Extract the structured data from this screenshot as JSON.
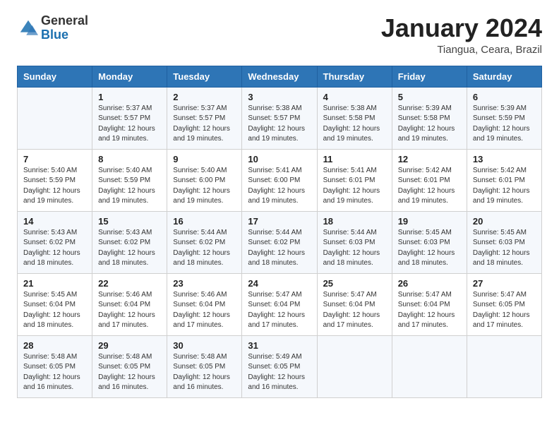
{
  "header": {
    "logo_general": "General",
    "logo_blue": "Blue",
    "title": "January 2024",
    "location": "Tiangua, Ceara, Brazil"
  },
  "columns": [
    "Sunday",
    "Monday",
    "Tuesday",
    "Wednesday",
    "Thursday",
    "Friday",
    "Saturday"
  ],
  "weeks": [
    [
      {
        "day": "",
        "info": ""
      },
      {
        "day": "1",
        "info": "Sunrise: 5:37 AM\nSunset: 5:57 PM\nDaylight: 12 hours\nand 19 minutes."
      },
      {
        "day": "2",
        "info": "Sunrise: 5:37 AM\nSunset: 5:57 PM\nDaylight: 12 hours\nand 19 minutes."
      },
      {
        "day": "3",
        "info": "Sunrise: 5:38 AM\nSunset: 5:57 PM\nDaylight: 12 hours\nand 19 minutes."
      },
      {
        "day": "4",
        "info": "Sunrise: 5:38 AM\nSunset: 5:58 PM\nDaylight: 12 hours\nand 19 minutes."
      },
      {
        "day": "5",
        "info": "Sunrise: 5:39 AM\nSunset: 5:58 PM\nDaylight: 12 hours\nand 19 minutes."
      },
      {
        "day": "6",
        "info": "Sunrise: 5:39 AM\nSunset: 5:59 PM\nDaylight: 12 hours\nand 19 minutes."
      }
    ],
    [
      {
        "day": "7",
        "info": "Sunrise: 5:40 AM\nSunset: 5:59 PM\nDaylight: 12 hours\nand 19 minutes."
      },
      {
        "day": "8",
        "info": "Sunrise: 5:40 AM\nSunset: 5:59 PM\nDaylight: 12 hours\nand 19 minutes."
      },
      {
        "day": "9",
        "info": "Sunrise: 5:40 AM\nSunset: 6:00 PM\nDaylight: 12 hours\nand 19 minutes."
      },
      {
        "day": "10",
        "info": "Sunrise: 5:41 AM\nSunset: 6:00 PM\nDaylight: 12 hours\nand 19 minutes."
      },
      {
        "day": "11",
        "info": "Sunrise: 5:41 AM\nSunset: 6:01 PM\nDaylight: 12 hours\nand 19 minutes."
      },
      {
        "day": "12",
        "info": "Sunrise: 5:42 AM\nSunset: 6:01 PM\nDaylight: 12 hours\nand 19 minutes."
      },
      {
        "day": "13",
        "info": "Sunrise: 5:42 AM\nSunset: 6:01 PM\nDaylight: 12 hours\nand 19 minutes."
      }
    ],
    [
      {
        "day": "14",
        "info": "Sunrise: 5:43 AM\nSunset: 6:02 PM\nDaylight: 12 hours\nand 18 minutes."
      },
      {
        "day": "15",
        "info": "Sunrise: 5:43 AM\nSunset: 6:02 PM\nDaylight: 12 hours\nand 18 minutes."
      },
      {
        "day": "16",
        "info": "Sunrise: 5:44 AM\nSunset: 6:02 PM\nDaylight: 12 hours\nand 18 minutes."
      },
      {
        "day": "17",
        "info": "Sunrise: 5:44 AM\nSunset: 6:02 PM\nDaylight: 12 hours\nand 18 minutes."
      },
      {
        "day": "18",
        "info": "Sunrise: 5:44 AM\nSunset: 6:03 PM\nDaylight: 12 hours\nand 18 minutes."
      },
      {
        "day": "19",
        "info": "Sunrise: 5:45 AM\nSunset: 6:03 PM\nDaylight: 12 hours\nand 18 minutes."
      },
      {
        "day": "20",
        "info": "Sunrise: 5:45 AM\nSunset: 6:03 PM\nDaylight: 12 hours\nand 18 minutes."
      }
    ],
    [
      {
        "day": "21",
        "info": "Sunrise: 5:45 AM\nSunset: 6:04 PM\nDaylight: 12 hours\nand 18 minutes."
      },
      {
        "day": "22",
        "info": "Sunrise: 5:46 AM\nSunset: 6:04 PM\nDaylight: 12 hours\nand 17 minutes."
      },
      {
        "day": "23",
        "info": "Sunrise: 5:46 AM\nSunset: 6:04 PM\nDaylight: 12 hours\nand 17 minutes."
      },
      {
        "day": "24",
        "info": "Sunrise: 5:47 AM\nSunset: 6:04 PM\nDaylight: 12 hours\nand 17 minutes."
      },
      {
        "day": "25",
        "info": "Sunrise: 5:47 AM\nSunset: 6:04 PM\nDaylight: 12 hours\nand 17 minutes."
      },
      {
        "day": "26",
        "info": "Sunrise: 5:47 AM\nSunset: 6:04 PM\nDaylight: 12 hours\nand 17 minutes."
      },
      {
        "day": "27",
        "info": "Sunrise: 5:47 AM\nSunset: 6:05 PM\nDaylight: 12 hours\nand 17 minutes."
      }
    ],
    [
      {
        "day": "28",
        "info": "Sunrise: 5:48 AM\nSunset: 6:05 PM\nDaylight: 12 hours\nand 16 minutes."
      },
      {
        "day": "29",
        "info": "Sunrise: 5:48 AM\nSunset: 6:05 PM\nDaylight: 12 hours\nand 16 minutes."
      },
      {
        "day": "30",
        "info": "Sunrise: 5:48 AM\nSunset: 6:05 PM\nDaylight: 12 hours\nand 16 minutes."
      },
      {
        "day": "31",
        "info": "Sunrise: 5:49 AM\nSunset: 6:05 PM\nDaylight: 12 hours\nand 16 minutes."
      },
      {
        "day": "",
        "info": ""
      },
      {
        "day": "",
        "info": ""
      },
      {
        "day": "",
        "info": ""
      }
    ]
  ]
}
